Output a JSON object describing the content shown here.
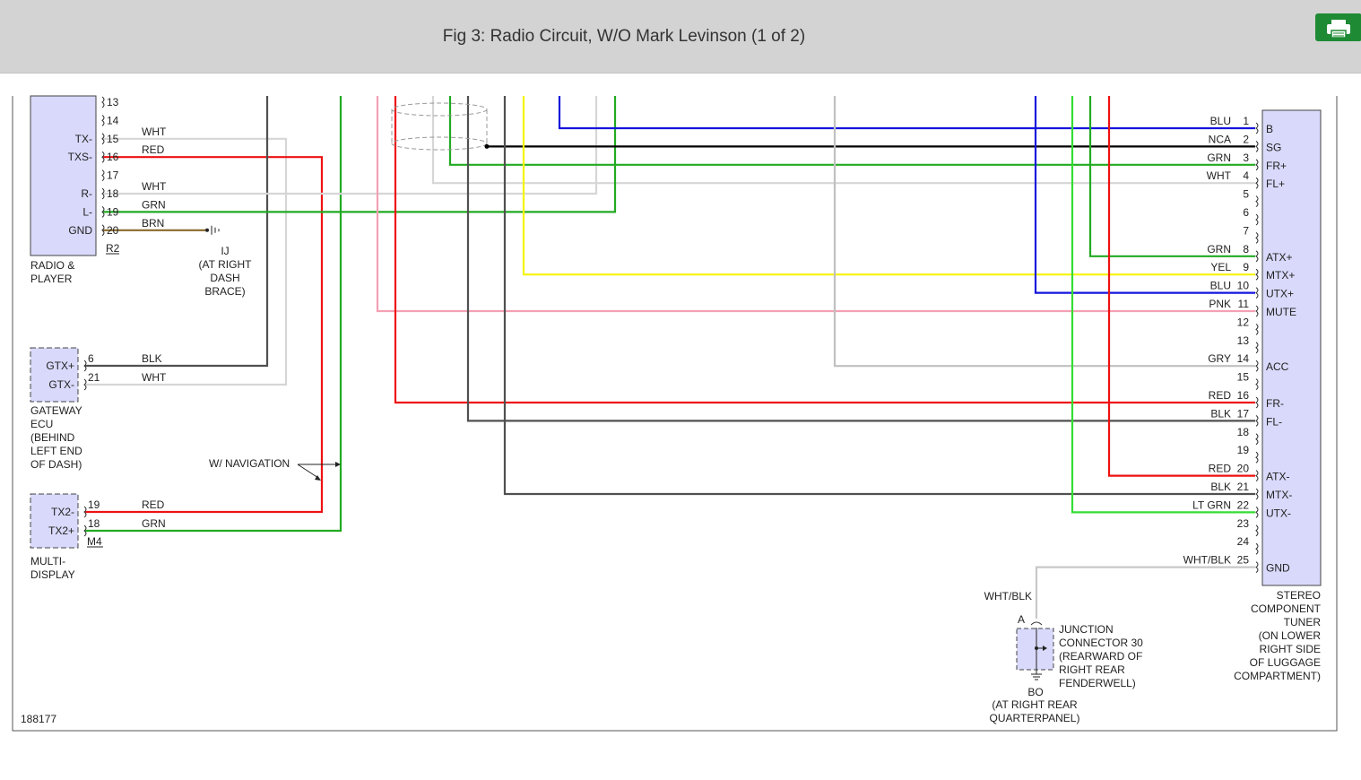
{
  "header": {
    "title": "Fig 3: Radio Circuit, W/O Mark Levinson (1 of 2)",
    "print_icon": "printer-icon",
    "accent": "#1e8a34"
  },
  "diagram": {
    "figure_number": "188177",
    "radio": {
      "label_lines": [
        "RADIO &",
        "PLAYER"
      ],
      "connector": "R2",
      "pins": [
        {
          "num": "13",
          "name": "",
          "wire": ""
        },
        {
          "num": "14",
          "name": "",
          "wire": ""
        },
        {
          "num": "15",
          "name": "TX-",
          "wire": "WHT"
        },
        {
          "num": "16",
          "name": "TXS-",
          "wire": "RED"
        },
        {
          "num": "17",
          "name": "",
          "wire": ""
        },
        {
          "num": "18",
          "name": "R-",
          "wire": "WHT"
        },
        {
          "num": "19",
          "name": "L-",
          "wire": "GRN"
        },
        {
          "num": "20",
          "name": "GND",
          "wire": "BRN"
        }
      ]
    },
    "ground_ij": {
      "label": "IJ",
      "location_lines": [
        "(AT RIGHT",
        "DASH",
        "BRACE)"
      ]
    },
    "gateway": {
      "label_lines": [
        "GATEWAY",
        "ECU",
        "(BEHIND",
        "LEFT END",
        "OF DASH)"
      ],
      "pins": [
        {
          "num": "6",
          "name": "GTX+",
          "wire": "BLK"
        },
        {
          "num": "21",
          "name": "GTX-",
          "wire": "WHT"
        }
      ]
    },
    "navigation_note": "W/ NAVIGATION",
    "multi_display": {
      "label_lines": [
        "MULTI-",
        "DISPLAY"
      ],
      "connector": "M4",
      "pins": [
        {
          "num": "19",
          "name": "TX2-",
          "wire": "RED"
        },
        {
          "num": "18",
          "name": "TX2+",
          "wire": "GRN"
        }
      ]
    },
    "tuner": {
      "label_lines": [
        "STEREO",
        "COMPONENT",
        "TUNER",
        "(ON LOWER",
        "RIGHT SIDE",
        "OF LUGGAGE",
        "COMPARTMENT)"
      ],
      "pins": [
        {
          "num": "1",
          "name": "B",
          "wire": "BLU"
        },
        {
          "num": "2",
          "name": "SG",
          "wire": "NCA"
        },
        {
          "num": "3",
          "name": "FR+",
          "wire": "GRN"
        },
        {
          "num": "4",
          "name": "FL+",
          "wire": "WHT"
        },
        {
          "num": "5",
          "name": "",
          "wire": ""
        },
        {
          "num": "6",
          "name": "",
          "wire": ""
        },
        {
          "num": "7",
          "name": "",
          "wire": ""
        },
        {
          "num": "8",
          "name": "ATX+",
          "wire": "GRN"
        },
        {
          "num": "9",
          "name": "MTX+",
          "wire": "YEL"
        },
        {
          "num": "10",
          "name": "UTX+",
          "wire": "BLU"
        },
        {
          "num": "11",
          "name": "MUTE",
          "wire": "PNK"
        },
        {
          "num": "12",
          "name": "",
          "wire": ""
        },
        {
          "num": "13",
          "name": "",
          "wire": ""
        },
        {
          "num": "14",
          "name": "ACC",
          "wire": "GRY"
        },
        {
          "num": "15",
          "name": "",
          "wire": ""
        },
        {
          "num": "16",
          "name": "FR-",
          "wire": "RED"
        },
        {
          "num": "17",
          "name": "FL-",
          "wire": "BLK"
        },
        {
          "num": "18",
          "name": "",
          "wire": ""
        },
        {
          "num": "19",
          "name": "",
          "wire": ""
        },
        {
          "num": "20",
          "name": "ATX-",
          "wire": "RED"
        },
        {
          "num": "21",
          "name": "MTX-",
          "wire": "BLK"
        },
        {
          "num": "22",
          "name": "UTX-",
          "wire": "LT GRN"
        },
        {
          "num": "23",
          "name": "",
          "wire": ""
        },
        {
          "num": "24",
          "name": "",
          "wire": ""
        },
        {
          "num": "25",
          "name": "GND",
          "wire": "WHT/BLK"
        }
      ]
    },
    "junction": {
      "wire": "WHT/BLK",
      "terminal": "A",
      "label_lines": [
        "JUNCTION",
        "CONNECTOR 30",
        "(REARWARD OF",
        "RIGHT REAR",
        "FENDERWELL)"
      ]
    },
    "ground_bo": {
      "label": "BO",
      "location_lines": [
        "(AT RIGHT REAR",
        "QUARTERPANEL)"
      ]
    },
    "wire_colors": {
      "RED": "#ee1111",
      "WHT": "#d6d6d6",
      "GRN": "#22aa22",
      "LTGRN": "#33dd33",
      "BLK": "#505050",
      "NCA": "#000000",
      "BLU": "#1515dd",
      "YEL": "#f5f500",
      "PNK": "#f4a0b4",
      "GRY": "#c0c0c0",
      "BRN": "#8a6a2a"
    }
  }
}
